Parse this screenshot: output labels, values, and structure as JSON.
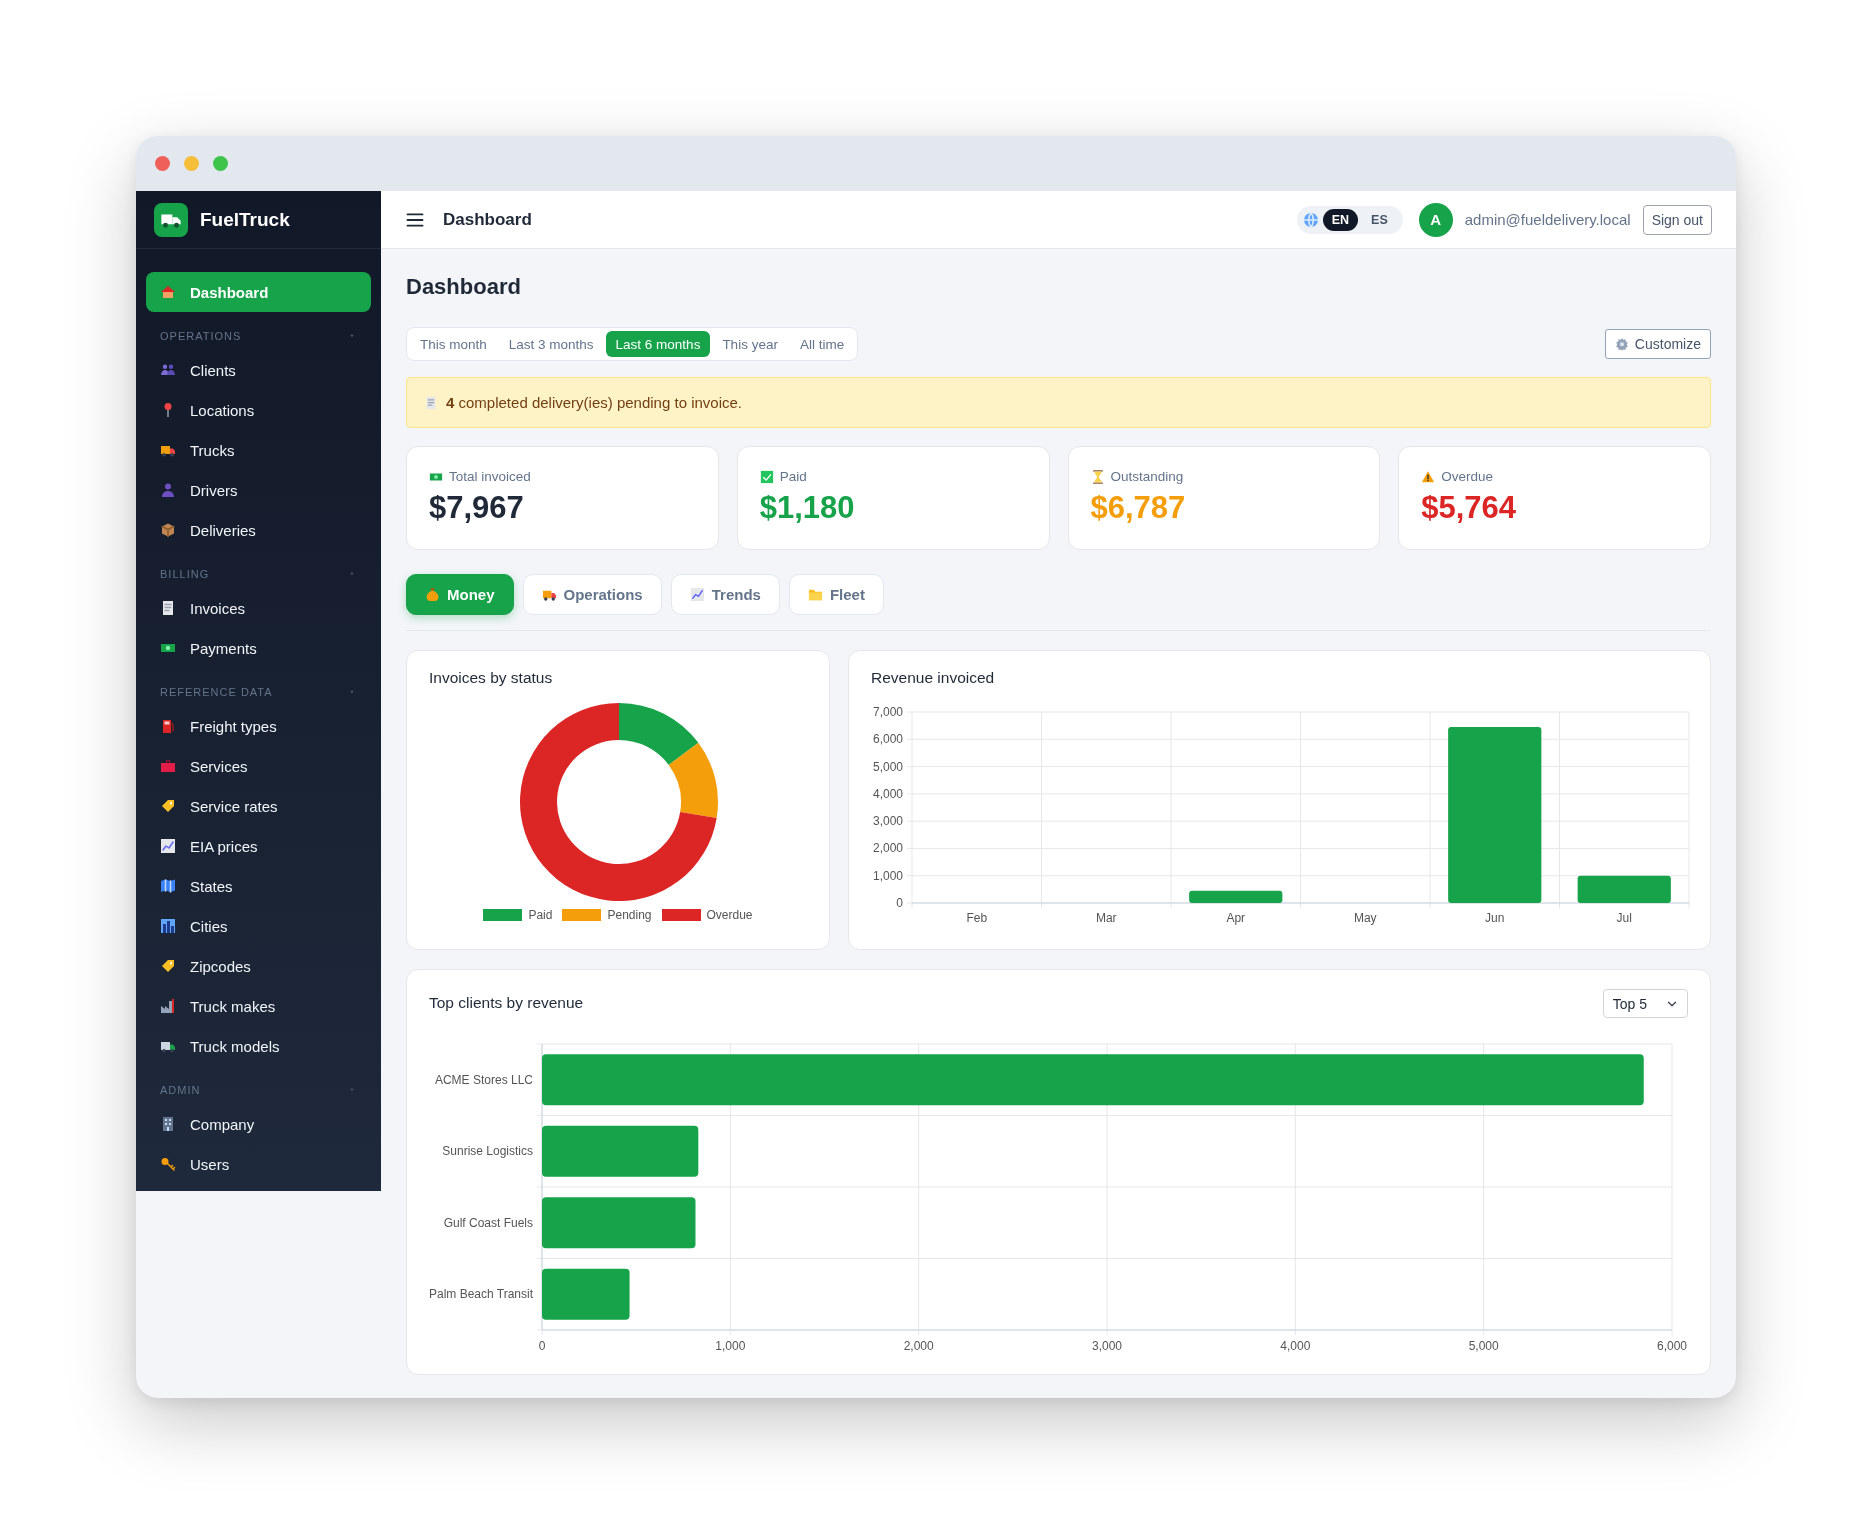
{
  "app": {
    "name": "FuelTruck"
  },
  "sidebar": {
    "items": [
      {
        "label": "Dashboard",
        "selected": true
      }
    ],
    "groups": [
      {
        "title": "OPERATIONS",
        "expanded": true,
        "items": [
          {
            "label": "Clients",
            "selected": false
          },
          {
            "label": "Locations",
            "selected": false
          },
          {
            "label": "Trucks",
            "selected": false
          },
          {
            "label": "Drivers",
            "selected": false
          },
          {
            "label": "Deliveries",
            "selected": false
          }
        ]
      },
      {
        "title": "BILLING",
        "expanded": true,
        "items": [
          {
            "label": "Invoices",
            "selected": false
          },
          {
            "label": "Payments",
            "selected": false
          }
        ]
      },
      {
        "title": "REFERENCE DATA",
        "expanded": true,
        "items": [
          {
            "label": "Freight types",
            "selected": false
          },
          {
            "label": "Services",
            "selected": false
          },
          {
            "label": "Service rates",
            "selected": false
          },
          {
            "label": "EIA prices",
            "selected": false
          },
          {
            "label": "States",
            "selected": false
          },
          {
            "label": "Cities",
            "selected": false
          },
          {
            "label": "Zipcodes",
            "selected": false
          },
          {
            "label": "Truck makes",
            "selected": false
          },
          {
            "label": "Truck models",
            "selected": false
          }
        ]
      },
      {
        "title": "ADMIN",
        "expanded": true,
        "items": [
          {
            "label": "Company",
            "selected": false
          },
          {
            "label": "Users",
            "selected": false
          }
        ]
      }
    ]
  },
  "topbar": {
    "title": "Dashboard",
    "languages": [
      {
        "label": "EN",
        "selected": true
      },
      {
        "label": "ES",
        "selected": false
      }
    ],
    "avatar": "A",
    "user": "admin@fueldelivery.local",
    "sign_out": "Sign out"
  },
  "page": {
    "heading": "Dashboard",
    "ranges": [
      {
        "label": "This month",
        "selected": false
      },
      {
        "label": "Last 3 months",
        "selected": false
      },
      {
        "label": "Last 6 months",
        "selected": true
      },
      {
        "label": "This year",
        "selected": false
      },
      {
        "label": "All time",
        "selected": false
      }
    ],
    "customize": "Customize",
    "alert": "**4** completed delivery(ies) pending to invoice.",
    "stats": [
      {
        "kind": "total",
        "label": "Total invoiced",
        "value": "$7,967",
        "color": "#1f2937"
      },
      {
        "kind": "paid",
        "label": "Paid",
        "value": "$1,180",
        "color": "#16a34a"
      },
      {
        "kind": "outstanding",
        "label": "Outstanding",
        "value": "$6,787",
        "color": "#f59e0b"
      },
      {
        "kind": "overdue",
        "label": "Overdue",
        "value": "$5,764",
        "color": "#dc2626"
      }
    ],
    "tabs": [
      {
        "label": "Money",
        "selected": true
      },
      {
        "label": "Operations",
        "selected": false
      },
      {
        "label": "Trends",
        "selected": false
      },
      {
        "label": "Fleet",
        "selected": false
      }
    ],
    "status_chart": {
      "chart_data": {
        "type": "donut",
        "title": "Invoices by status",
        "categories": [
          "Paid",
          "Pending",
          "Overdue"
        ],
        "values": [
          14.8,
          12.8,
          72.4
        ],
        "legend": true,
        "colors": [
          "#16a34a",
          "#f59e0b",
          "#dc2626"
        ]
      }
    },
    "revenue_chart": {
      "chart_data": {
        "type": "bar",
        "title": "Revenue invoiced",
        "categories": [
          "Feb",
          "Mar",
          "Apr",
          "May",
          "Jun",
          "Jul"
        ],
        "series": [
          {
            "color": "#16a34a",
            "values": [
              0,
              0,
              450,
              0,
              6450,
              1000
            ]
          }
        ],
        "grid": true,
        "ylim": [
          0,
          7000
        ],
        "yticks": [
          0,
          {
            "value": 1000,
            "label": "1,000"
          },
          {
            "value": 2000,
            "label": "2,000"
          },
          {
            "value": 3000,
            "label": "3,000"
          },
          {
            "value": 4000,
            "label": "4,000"
          },
          {
            "value": 5000,
            "label": "5,000"
          },
          {
            "value": 6000,
            "label": "6,000"
          },
          {
            "value": 7000,
            "label": "7,000"
          }
        ]
      }
    },
    "clients_chart": {
      "select": "Top 5",
      "chart_data": {
        "type": "bar",
        "orientation": "horizontal",
        "title": "Top clients by revenue",
        "categories": [
          "ACME Stores LLC",
          "Sunrise Logistics",
          "Gulf Coast Fuels",
          "Palm Beach Transit"
        ],
        "series": [
          {
            "color": "#16a34a",
            "values": [
              5850,
              830,
              815,
              465
            ]
          }
        ],
        "grid": true,
        "xlim": [
          0,
          6000
        ],
        "xticks": [
          0,
          {
            "value": 1000,
            "label": "1,000"
          },
          {
            "value": 2000,
            "label": "2,000"
          },
          {
            "value": 3000,
            "label": "3,000"
          },
          {
            "value": 4000,
            "label": "4,000"
          },
          {
            "value": 5000,
            "label": "5,000"
          },
          {
            "value": 6000,
            "label": "6,000"
          }
        ]
      }
    }
  }
}
